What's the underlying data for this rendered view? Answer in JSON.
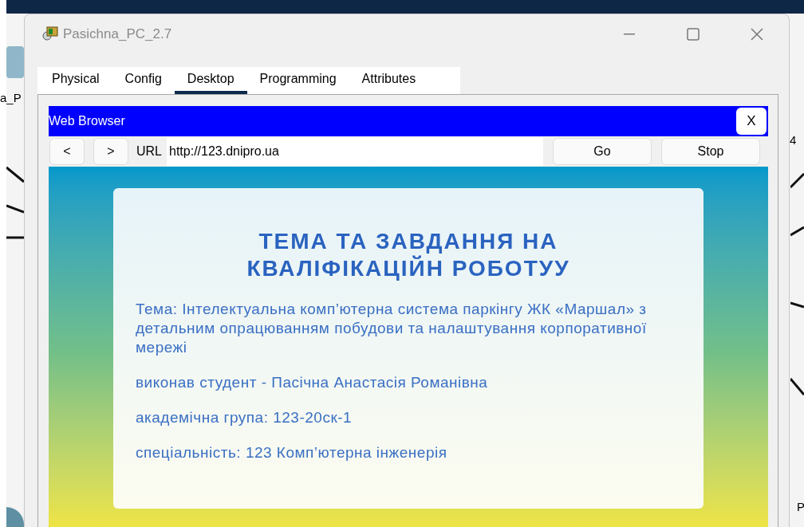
{
  "background": {
    "labels": [
      {
        "text": "a_P"
      },
      {
        "text": "4"
      },
      {
        "text": "P"
      }
    ]
  },
  "window": {
    "title": "Pasichna_PC_2.7"
  },
  "tabs": [
    {
      "label": "Physical",
      "selected": false
    },
    {
      "label": "Config",
      "selected": false
    },
    {
      "label": "Desktop",
      "selected": true
    },
    {
      "label": "Programming",
      "selected": false
    },
    {
      "label": "Attributes",
      "selected": false
    }
  ],
  "browser": {
    "title": "Web Browser",
    "close": "X",
    "back": "<",
    "forward": ">",
    "url_label": "URL",
    "url": "http://123.dnipro.ua",
    "go": "Go",
    "stop": "Stop"
  },
  "page": {
    "heading": "ТЕМА ТА ЗАВДАННЯ НА КВАЛІФІКАЦІЙН РОБОТУУ",
    "paragraphs": [
      "Тема: Інтелектуальна комп’ютерна система паркінгу ЖК «Маршал» з детальним опрацюванням побудови та налаштування корпоративної мережі",
      "виконав студент - Пасічна Анастасія Романівна",
      "академічна група: 123-20ск-1",
      "спеціальність: 123 Комп’ютерна інженерія"
    ]
  }
}
